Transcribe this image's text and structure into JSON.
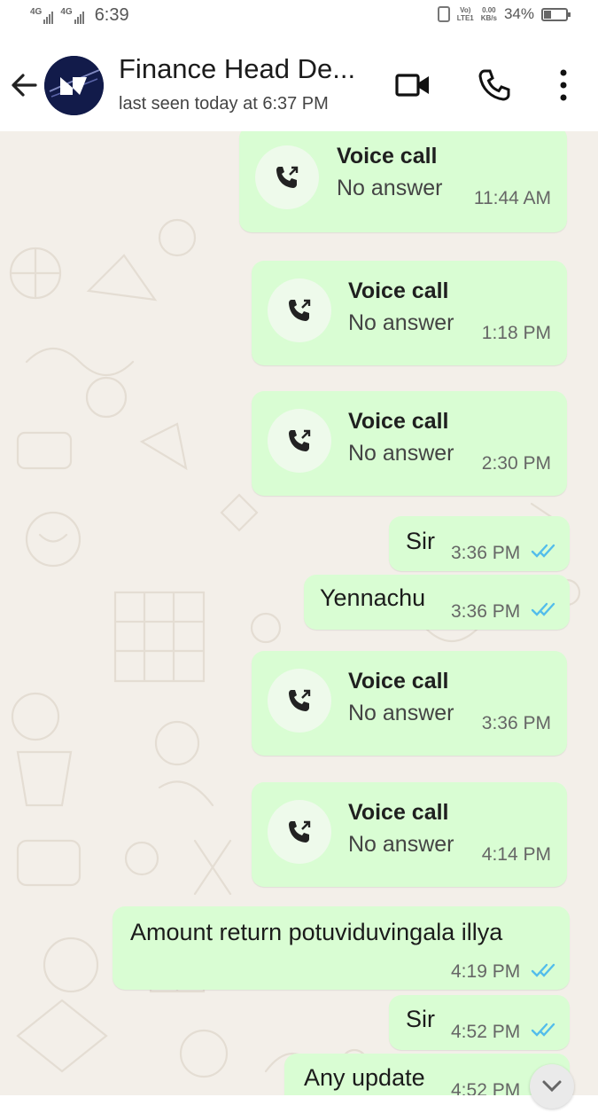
{
  "status_bar": {
    "sim1": "4G",
    "sim2": "4G",
    "time": "6:39",
    "volte_top": "Vo)",
    "volte_bottom": "LTE1",
    "speed_top": "0.00",
    "speed_bottom": "KB/s",
    "battery": "34%"
  },
  "header": {
    "title": "Finance Head De...",
    "subtitle": "last seen today at 6:37 PM"
  },
  "colors": {
    "bubble": "#d9fdd3",
    "chat_background": "#f3efe9",
    "read_tick": "#53bdeb"
  },
  "messages": [
    {
      "type": "call",
      "title": "Voice call",
      "status": "No answer",
      "time": "11:44 AM"
    },
    {
      "type": "call",
      "title": "Voice call",
      "status": "No answer",
      "time": "1:18 PM"
    },
    {
      "type": "call",
      "title": "Voice call",
      "status": "No answer",
      "time": "2:30 PM"
    },
    {
      "type": "text",
      "text": "Sir",
      "time": "3:36 PM",
      "read": true
    },
    {
      "type": "text",
      "text": "Yennachu",
      "time": "3:36 PM",
      "read": true
    },
    {
      "type": "call",
      "title": "Voice call",
      "status": "No answer",
      "time": "3:36 PM"
    },
    {
      "type": "call",
      "title": "Voice call",
      "status": "No answer",
      "time": "4:14 PM"
    },
    {
      "type": "text",
      "text": "Amount return potuviduvingala illya",
      "time": "4:19 PM",
      "read": true
    },
    {
      "type": "text",
      "text": "Sir",
      "time": "4:52 PM",
      "read": true
    },
    {
      "type": "text",
      "text": "Any update",
      "time": "4:52 PM",
      "read": true
    }
  ]
}
